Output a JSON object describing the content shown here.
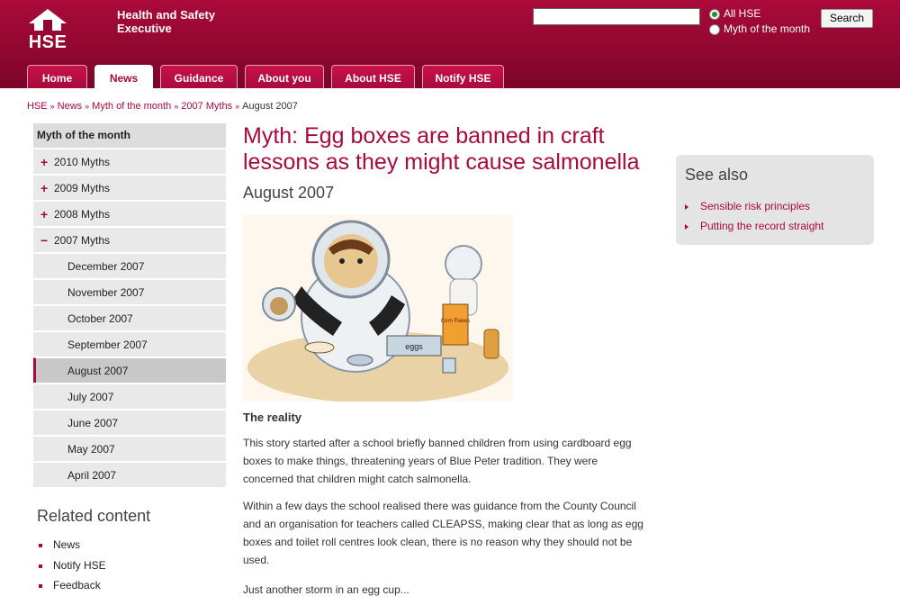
{
  "header": {
    "logo_text": "HSE",
    "org_line1": "Health and Safety",
    "org_line2": "Executive",
    "search_value": "",
    "radio_all": "All HSE",
    "radio_myth": "Myth of the month",
    "search_button": "Search"
  },
  "tabs": [
    "Home",
    "News",
    "Guidance",
    "About you",
    "About HSE",
    "Notify HSE"
  ],
  "breadcrumb": [
    "HSE",
    "News",
    "Myth of the month",
    "2007 Myths",
    "August 2007"
  ],
  "sidebar": {
    "heading": "Myth of the month",
    "years": [
      "2010 Myths",
      "2009 Myths",
      "2008 Myths",
      "2007 Myths"
    ],
    "year_markers": [
      "+",
      "+",
      "+",
      "−"
    ],
    "months": [
      "December 2007",
      "November 2007",
      "October 2007",
      "September 2007",
      "August 2007",
      "July 2007",
      "June 2007",
      "May 2007",
      "April 2007"
    ]
  },
  "related": {
    "title": "Related content",
    "items": [
      "News",
      "Notify HSE",
      "Feedback"
    ]
  },
  "main": {
    "title_line1": "Myth: Egg boxes are banned in craft",
    "title_line2": "lessons as they might cause salmonella",
    "date": "August 2007",
    "reality": "The reality",
    "p1_l1": "This story started after a school briefly banned children from using cardboard egg",
    "p1_l2": "boxes to make things, threatening years of Blue Peter tradition. They were",
    "p1_l3": "concerned that children might catch salmonella.",
    "p2_l1": "Within a few days the school realised there was guidance from the County Council",
    "p2_l2": "and an organisation for teachers called CLEAPSS, making clear that as long as egg",
    "p2_l3": "boxes and toilet roll centres look clean, there is no reason why they should not be",
    "p2_l4": "used.",
    "p3": "Just another storm in an egg cup...",
    "cartoon_egg_label": "eggs",
    "cartoon_box_label": "Corn Flakes"
  },
  "see_also": {
    "title": "See also",
    "items": [
      "Sensible risk principles",
      "Putting the record straight"
    ]
  },
  "colors": {
    "brand": "#a80a3c",
    "header": "#8f0730"
  }
}
